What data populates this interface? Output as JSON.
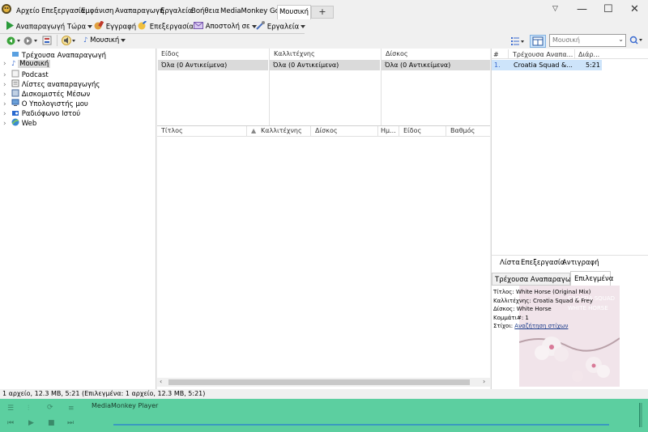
{
  "app": {
    "title": "MediaMonkey"
  },
  "menu": {
    "items": [
      "Αρχείο",
      "Επεξεργασία",
      "Εμφάνιση",
      "Αναπαραγωγή",
      "Εργαλεία",
      "Βοήθεια",
      "MediaMonkey Gold"
    ],
    "active_tab": "Μουσική",
    "add_tab": "+"
  },
  "toolbar": {
    "play_now": "Αναπαραγωγή Τώρα",
    "burn": "Εγγραφή",
    "edit": "Επεξεργασία",
    "send_to": "Αποστολή σε",
    "tools": "Εργαλεία"
  },
  "toolbar2": {
    "node": "Μουσική",
    "search_placeholder": "Μουσική"
  },
  "tree": {
    "items": [
      "Τρέχουσα Αναπαραγωγή",
      "Μουσική",
      "Podcast",
      "Λίστες αναπαραγωγής",
      "Δισκομιστές Μέσων",
      "Ο Υπολογιστής μου",
      "Ραδιόφωνο Ιστού",
      "Web"
    ]
  },
  "browser": {
    "columns": [
      {
        "header": "Είδος",
        "all": "Όλα (0 Αντικείμενα)"
      },
      {
        "header": "Καλλιτέχνης",
        "all": "Όλα (0 Αντικείμενα)"
      },
      {
        "header": "Δίσκος",
        "all": "Όλα (0 Αντικείμενα)"
      }
    ]
  },
  "grid": {
    "headers": [
      "Τίτλος",
      "Καλλιτέχνης",
      "Δίσκος",
      "Ημ...",
      "Είδος",
      "Βαθμός"
    ]
  },
  "now_playing": {
    "headers": [
      "#",
      "Τρέχουσα Αναπα...",
      "Διάρ..."
    ],
    "rows": [
      {
        "num": "1.",
        "title": "Croatia Squad &...",
        "dur": "5:21"
      }
    ],
    "footer": [
      "Λίστα",
      "Επεξεργασία",
      "Αντιγραφή"
    ]
  },
  "info": {
    "tabs": [
      "Τρέχουσα Αναπαραγωγή",
      "Επιλεγμένα"
    ],
    "title_line": "Τίτλος: White Horse (Original Mix)",
    "artist_line": "Καλλιτέχνης: Croatia Squad & Frey",
    "album_line": "Δίσκος: White Horse",
    "track_line": "Κομμάτι#: 1",
    "lyrics_label": "Στίχοι:",
    "lyrics_link": "Αναζήτηση στίχων",
    "art_text_1": "CROATIA SQUAD",
    "art_text_2": "WHITE HORSE"
  },
  "status": "1 αρχείο, 12.3 MB, 5:21 (Επιλεγμένα: 1 αρχείο, 12.3 MB, 5:21)",
  "player": {
    "label": "MediaMonkey Player"
  },
  "colors": {
    "player_bg": "#5ccfa0",
    "accent": "#2a7fd0",
    "selection": "#dadada"
  }
}
